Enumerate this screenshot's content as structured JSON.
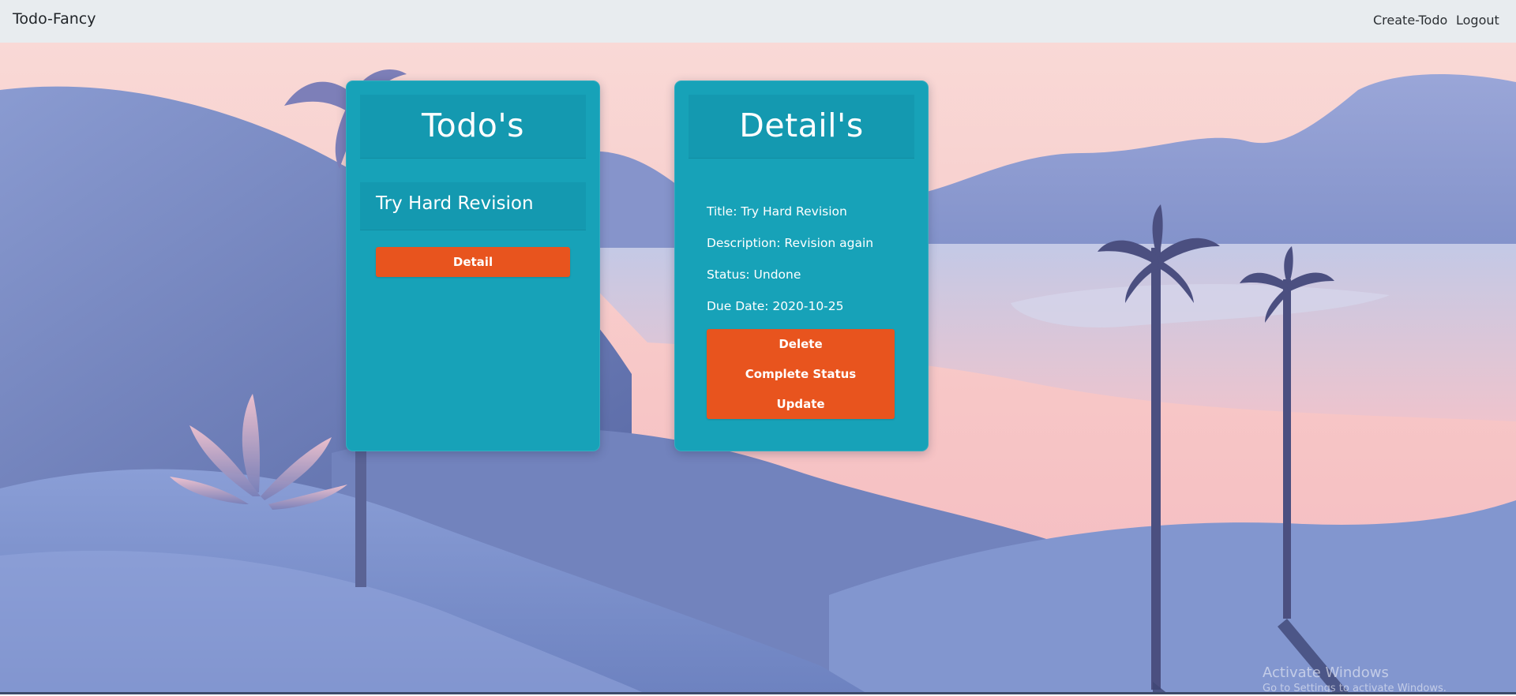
{
  "navbar": {
    "brand": "Todo-Fancy",
    "links": [
      {
        "label": "Create-Todo"
      },
      {
        "label": "Logout"
      }
    ]
  },
  "todos_panel": {
    "heading": "Todo's",
    "items": [
      {
        "title": "Try Hard Revision",
        "button_label": "Detail"
      }
    ]
  },
  "details_panel": {
    "heading": "Detail's",
    "title_line": "Title: Try Hard Revision",
    "description_line": "Description: Revision again",
    "status_line": "Status: Undone",
    "due_date_line": "Due Date: 2020-10-25",
    "actions": {
      "delete": "Delete",
      "complete": "Complete Status",
      "update": "Update"
    }
  },
  "watermark": {
    "title": "Activate Windows",
    "subtitle": "Go to Settings to activate Windows."
  },
  "colors": {
    "navbar_bg": "#e8ecef",
    "card_bg": "#17a2b8",
    "card_header_bg": "#1499b0",
    "button_bg": "#e8541e",
    "sky_top": "#f8dcd8",
    "mountain": "#6f82bd"
  }
}
